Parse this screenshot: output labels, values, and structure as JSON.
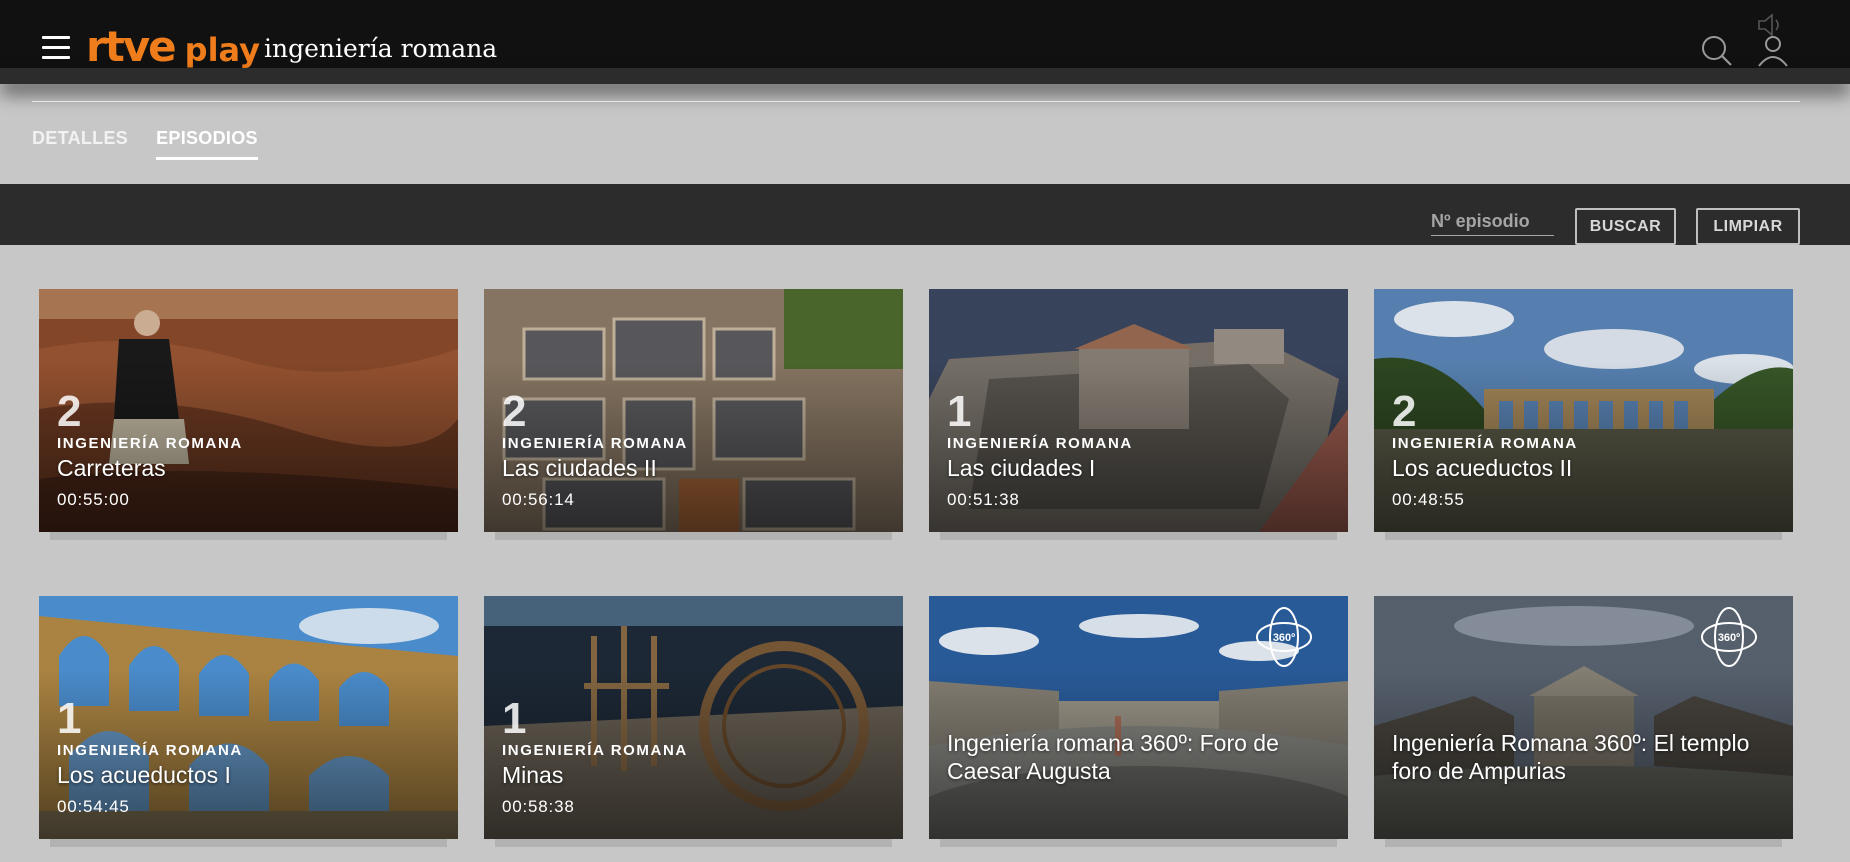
{
  "header": {
    "logo_main": "rtve",
    "logo_sub": "play",
    "title": "ingeniería romana",
    "menu_icon": "hamburger-menu-icon",
    "search_icon": "search-icon",
    "user_icon": "user-icon",
    "sound_icon": "speaker-icon",
    "brand_color": "#f07d1b"
  },
  "tabs": [
    {
      "label": "DETALLES",
      "active": false
    },
    {
      "label": "EPISODIOS",
      "active": true
    }
  ],
  "filter": {
    "placeholder": "Nº episodio",
    "search_label": "BUSCAR",
    "clear_label": "LIMPIAR"
  },
  "episodes": [
    {
      "number": "2",
      "series": "INGENIERÍA ROMANA",
      "title": "Carreteras",
      "duration": "00:55:00"
    },
    {
      "number": "2",
      "series": "INGENIERÍA ROMANA",
      "title": "Las ciudades II",
      "duration": "00:56:14"
    },
    {
      "number": "1",
      "series": "INGENIERÍA ROMANA",
      "title": "Las ciudades I",
      "duration": "00:51:38"
    },
    {
      "number": "2",
      "series": "INGENIERÍA ROMANA",
      "title": "Los acueductos II",
      "duration": "00:48:55"
    },
    {
      "number": "1",
      "series": "INGENIERÍA ROMANA",
      "title": "Los acueductos I",
      "duration": "00:54:45"
    },
    {
      "number": "1",
      "series": "INGENIERÍA ROMANA",
      "title": "Minas",
      "duration": "00:58:38"
    },
    {
      "title": "Ingeniería romana 360º: Foro de Caesar Augusta",
      "badge": "360º"
    },
    {
      "title": "Ingeniería Romana 360º: El templo foro de Ampurias",
      "badge": "360º"
    }
  ]
}
